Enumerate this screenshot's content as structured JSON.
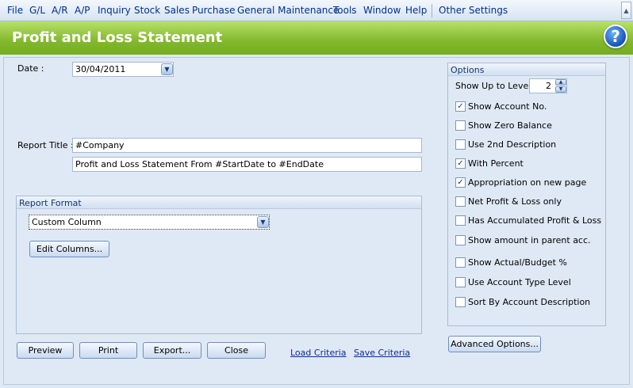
{
  "menu": {
    "items": [
      {
        "id": "file",
        "label": "File"
      },
      {
        "id": "gl",
        "label": "G/L"
      },
      {
        "id": "ar",
        "label": "A/R"
      },
      {
        "id": "ap",
        "label": "A/P"
      },
      {
        "id": "inquiry",
        "label": "Inquiry"
      },
      {
        "id": "stock",
        "label": "Stock"
      },
      {
        "id": "sales",
        "label": "Sales"
      },
      {
        "id": "purchase",
        "label": "Purchase"
      },
      {
        "id": "general-maintenance",
        "label": "General Maintenance"
      },
      {
        "id": "tools",
        "label": "Tools"
      },
      {
        "id": "window",
        "label": "Window"
      },
      {
        "id": "help",
        "label": "Help"
      },
      {
        "id": "other-settings",
        "label": "Other Settings"
      }
    ]
  },
  "header": {
    "title": "Profit and Loss Statement",
    "help_icon": "question-mark-icon"
  },
  "form": {
    "date_label": "Date :",
    "date_value": "30/04/2011",
    "report_title_label": "Report Title :",
    "report_title_1": "#Company",
    "report_title_2": "Profit and Loss Statement From #StartDate to #EndDate"
  },
  "report_format": {
    "heading": "Report Format",
    "selected": "Custom Column",
    "edit_columns_label": "Edit Columns..."
  },
  "buttons": {
    "preview": "Preview",
    "print": "Print",
    "export": "Export...",
    "close": "Close",
    "load_criteria": "Load Criteria",
    "save_criteria": "Save Criteria",
    "advanced_options": "Advanced Options..."
  },
  "options": {
    "heading": "Options",
    "show_up_to_level_label": "Show Up to Level",
    "show_up_to_level_value": "2",
    "items": [
      {
        "label": "Show Account No.",
        "checked": true
      },
      {
        "label": "Show Zero Balance",
        "checked": false
      },
      {
        "label": "Use 2nd Description",
        "checked": false
      },
      {
        "label": "With Percent",
        "checked": true
      },
      {
        "label": "Appropriation on new page",
        "checked": true
      },
      {
        "label": "Net Profit & Loss only",
        "checked": false
      },
      {
        "label": "Has Accumulated Profit & Loss",
        "checked": false
      },
      {
        "label": "Show amount in parent acc.",
        "checked": false
      },
      {
        "label": "Show Actual/Budget %",
        "checked": false
      },
      {
        "label": "Use Account Type Level",
        "checked": false
      },
      {
        "label": "Sort By Account Description",
        "checked": false
      }
    ]
  },
  "colors": {
    "accent_green": "#82b82c",
    "link_blue": "#0d2c8a",
    "panel": "#dfe9f5"
  }
}
